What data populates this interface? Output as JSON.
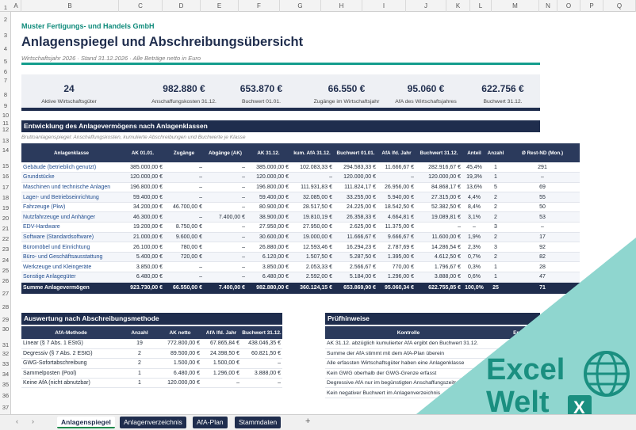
{
  "columns": [
    "A",
    "B",
    "C",
    "D",
    "E",
    "F",
    "G",
    "H",
    "I",
    "J",
    "K",
    "L",
    "M",
    "N",
    "O",
    "P",
    "Q"
  ],
  "rows": [
    "1",
    "2",
    "3",
    "4",
    "5",
    "6",
    "7",
    "8",
    "9",
    "10",
    "11",
    "12",
    "13",
    "14",
    "15",
    "16",
    "17",
    "18",
    "19",
    "20",
    "21",
    "22",
    "23",
    "24",
    "25",
    "26",
    "27",
    "28",
    "29",
    "30",
    "31",
    "32",
    "33",
    "34",
    "35",
    "36",
    "37"
  ],
  "header": {
    "company": "Muster Fertigungs- und Handels GmbH",
    "title": "Anlagenspiegel und Abschreibungsübersicht",
    "subtitle": "Wirtschaftsjahr 2026  ·  Stand 31.12.2026  ·  Alle Beträge netto in Euro"
  },
  "kpis": [
    {
      "value": "24",
      "label": "Aktive Wirtschaftsgüter"
    },
    {
      "value": "982.880 €",
      "label": "Anschaffungskosten 31.12."
    },
    {
      "value": "653.870 €",
      "label": "Buchwert 01.01."
    },
    {
      "value": "66.550 €",
      "label": "Zugänge im Wirtschaftsjahr"
    },
    {
      "value": "95.060 €",
      "label": "AfA des Wirtschaftsjahres"
    },
    {
      "value": "622.756 €",
      "label": "Buchwert 31.12."
    }
  ],
  "section1": {
    "title": "Entwicklung des Anlagevermögens nach Anlagenklassen",
    "note": "Bruttoanlagenspiegel: Anschaffungskosten, kumulierte Abschreibungen und Buchwerte je Klasse",
    "headers": [
      "Anlagenklasse",
      "AK 01.01.",
      "Zugänge",
      "Abgänge (AK)",
      "AK 31.12.",
      "kum. AfA 31.12.",
      "Buchwert 01.01.",
      "AfA lfd. Jahr",
      "Buchwert 31.12.",
      "Anteil",
      "Anzahl",
      "Ø Rest-ND (Mon.)"
    ],
    "rows": [
      [
        "Gebäude (betrieblich genutzt)",
        "385.000,00 €",
        "–",
        "–",
        "385.000,00 €",
        "102.083,33 €",
        "294.583,33 €",
        "11.666,67 €",
        "282.916,67 €",
        "45,4%",
        "1",
        "291"
      ],
      [
        "Grundstücke",
        "120.000,00 €",
        "–",
        "–",
        "120.000,00 €",
        "–",
        "120.000,00 €",
        "–",
        "120.000,00 €",
        "19,3%",
        "1",
        "–"
      ],
      [
        "Maschinen und technische Anlagen",
        "196.800,00 €",
        "–",
        "–",
        "196.800,00 €",
        "111.931,83 €",
        "111.824,17 €",
        "26.956,00 €",
        "84.868,17 €",
        "13,6%",
        "5",
        "69"
      ],
      [
        "Lager- und Betriebseinrichtung",
        "59.400,00 €",
        "–",
        "–",
        "59.400,00 €",
        "32.085,00 €",
        "33.255,00 €",
        "5.940,00 €",
        "27.315,00 €",
        "4,4%",
        "2",
        "55"
      ],
      [
        "Fahrzeuge (Pkw)",
        "34.200,00 €",
        "46.700,00 €",
        "–",
        "80.900,00 €",
        "28.517,50 €",
        "24.225,00 €",
        "18.542,50 €",
        "52.382,50 €",
        "8,4%",
        "2",
        "50"
      ],
      [
        "Nutzfahrzeuge und Anhänger",
        "46.300,00 €",
        "–",
        "7.400,00 €",
        "38.900,00 €",
        "19.810,19 €",
        "26.358,33 €",
        "4.664,81 €",
        "19.089,81 €",
        "3,1%",
        "2",
        "53"
      ],
      [
        "EDV-Hardware",
        "19.200,00 €",
        "8.750,00 €",
        "–",
        "27.950,00 €",
        "27.950,00 €",
        "2.625,00 €",
        "11.375,00 €",
        "–",
        "–",
        "3",
        "–"
      ],
      [
        "Software (Standardsoftware)",
        "21.000,00 €",
        "9.600,00 €",
        "–",
        "30.600,00 €",
        "19.000,00 €",
        "11.666,67 €",
        "9.666,67 €",
        "11.600,00 €",
        "1,9%",
        "2",
        "17"
      ],
      [
        "Büromöbel und Einrichtung",
        "26.100,00 €",
        "780,00 €",
        "–",
        "26.880,00 €",
        "12.593,46 €",
        "16.294,23 €",
        "2.787,69 €",
        "14.286,54 €",
        "2,3%",
        "3",
        "92"
      ],
      [
        "Büro- und Geschäftsausstattung",
        "5.400,00 €",
        "720,00 €",
        "–",
        "6.120,00 €",
        "1.507,50 €",
        "5.287,50 €",
        "1.395,00 €",
        "4.612,50 €",
        "0,7%",
        "2",
        "82"
      ],
      [
        "Werkzeuge und Kleingeräte",
        "3.850,00 €",
        "–",
        "–",
        "3.850,00 €",
        "2.053,33 €",
        "2.566,67 €",
        "770,00 €",
        "1.796,67 €",
        "0,3%",
        "1",
        "28"
      ],
      [
        "Sonstige Anlagegüter",
        "6.480,00 €",
        "–",
        "–",
        "6.480,00 €",
        "2.592,00 €",
        "5.184,00 €",
        "1.296,00 €",
        "3.888,00 €",
        "0,6%",
        "1",
        "47"
      ]
    ],
    "sum": [
      "Summe Anlagevermögen",
      "923.730,00 €",
      "66.550,00 €",
      "7.400,00 €",
      "982.880,00 €",
      "360.124,15 €",
      "653.869,90 €",
      "95.060,34 €",
      "622.755,85 €",
      "100,0%",
      "25",
      "71"
    ]
  },
  "section2": {
    "title": "Auswertung nach Abschreibungsmethode",
    "headers": [
      "AfA-Methode",
      "Anzahl",
      "AK netto",
      "AfA lfd. Jahr",
      "Buchwert 31.12."
    ],
    "rows": [
      [
        "Linear (§ 7 Abs. 1 EStG)",
        "19",
        "772.800,00 €",
        "67.865,84 €",
        "438.046,35 €"
      ],
      [
        "Degressiv (§ 7 Abs. 2 EStG)",
        "2",
        "89.500,00 €",
        "24.398,50 €",
        "60.821,50 €"
      ],
      [
        "GWG-Sofortabschreibung",
        "2",
        "1.500,00 €",
        "1.500,00 €",
        "–"
      ],
      [
        "Sammelposten (Pool)",
        "1",
        "6.480,00 €",
        "1.296,00 €",
        "3.888,00 €"
      ],
      [
        "Keine AfA (nicht abnutzbar)",
        "1",
        "120.000,00 €",
        "–",
        "–"
      ]
    ]
  },
  "section3": {
    "title": "Prüfhinweise",
    "headers": [
      "Kontrolle",
      "Er"
    ],
    "rows": [
      [
        "AK 31.12. abzüglich kumulierter AfA ergibt den Buchwert 31.12."
      ],
      [
        "Summe der AfA stimmt mit dem AfA-Plan überein"
      ],
      [
        "Alle erfassten Wirtschaftsgüter haben eine Anlagenklasse"
      ],
      [
        "Kein GWG oberhalb der GWG-Grenze erfasst"
      ],
      [
        "Degressive AfA nur im begünstigten Anschaffungszeitraum"
      ],
      [
        "Kein negativer Buchwert im Anlagenverzeichnis"
      ]
    ]
  },
  "logo": {
    "line1": "Excel",
    "line2": "Welt",
    "brand_color": "#1a8f80",
    "accent_color": "#8fd6cf"
  },
  "tabs": [
    "Anlagenspiegel",
    "Anlagenverzeichnis",
    "AfA-Plan",
    "Stammdaten"
  ],
  "tabbar": {
    "prev": "‹",
    "next": "›",
    "add": "+"
  }
}
